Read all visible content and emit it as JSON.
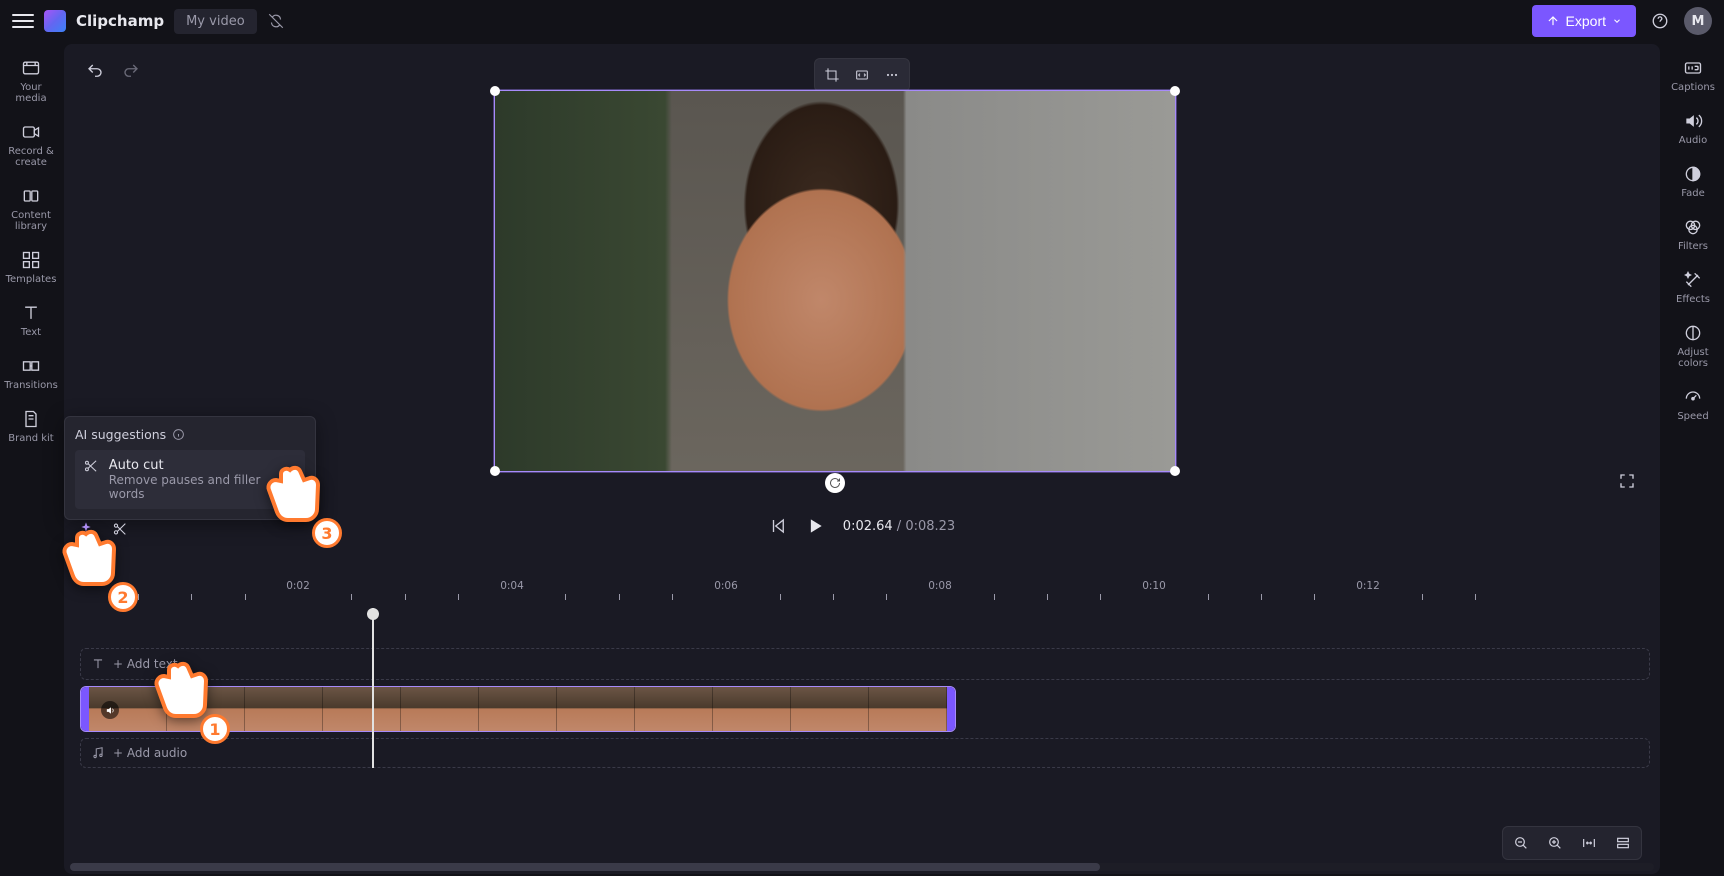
{
  "app": {
    "brand": "Clipchamp",
    "title": "My video"
  },
  "header": {
    "export_label": "Export",
    "avatar_initial": "M"
  },
  "left_sidebar": {
    "items": [
      {
        "label": "Your media"
      },
      {
        "label": "Record & create"
      },
      {
        "label": "Content library"
      },
      {
        "label": "Templates"
      },
      {
        "label": "Text"
      },
      {
        "label": "Transitions"
      },
      {
        "label": "Brand kit"
      }
    ]
  },
  "right_sidebar": {
    "items": [
      {
        "label": "Captions"
      },
      {
        "label": "Audio"
      },
      {
        "label": "Fade"
      },
      {
        "label": "Filters"
      },
      {
        "label": "Effects"
      },
      {
        "label": "Adjust colors"
      },
      {
        "label": "Speed"
      }
    ]
  },
  "ai_popup": {
    "heading": "AI suggestions",
    "option_title": "Auto cut",
    "option_sub": "Remove pauses and filler words"
  },
  "playback": {
    "current": "0:02.64",
    "separator": " / ",
    "duration": "0:08.23"
  },
  "ruler": {
    "labels": [
      "0:02",
      "0:04",
      "0:06",
      "0:08",
      "0:10",
      "0:12"
    ]
  },
  "tracks": {
    "text_add": "+ Add text",
    "audio_add": "+ Add audio"
  },
  "tutorial": {
    "step1": "1",
    "step2": "2",
    "step3": "3"
  }
}
